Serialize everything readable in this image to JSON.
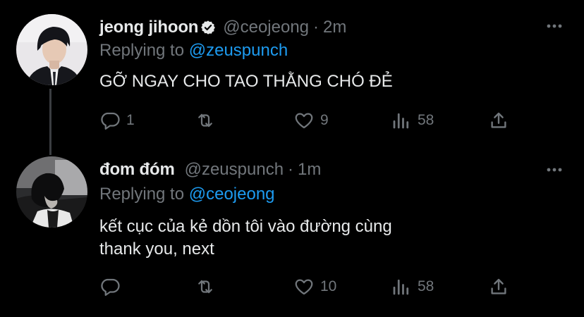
{
  "tweets": [
    {
      "name": "jeong jihoon",
      "verified": true,
      "handle": "@ceojeong",
      "separator": "·",
      "time": "2m",
      "replying_prefix": "Replying to",
      "replying_to": "@zeuspunch",
      "text_lines": [
        "GỠ NGAY CHO TAO THẰNG CHÓ ĐẺ"
      ],
      "stats": {
        "replies": "1",
        "retweets": "",
        "likes": "9",
        "views": "58"
      }
    },
    {
      "name": "đom đóm",
      "verified": false,
      "handle": "@zeuspunch",
      "separator": "·",
      "time": "1m",
      "replying_prefix": "Replying to",
      "replying_to": "@ceojeong",
      "text_lines": [
        "kết cục của kẻ dồn tôi vào đường cùng",
        "thank you, next"
      ],
      "stats": {
        "replies": "",
        "retweets": "",
        "likes": "10",
        "views": "58"
      }
    }
  ],
  "icons": {
    "reply": "reply-icon",
    "retweet": "retweet-icon",
    "like": "heart-icon",
    "views": "views-icon",
    "share": "share-icon",
    "more": "more-icon",
    "verified": "verified-badge-icon"
  },
  "colors": {
    "background": "#000000",
    "text": "#e7e9ea",
    "muted": "#71767b",
    "accent": "#1d9bf0"
  }
}
